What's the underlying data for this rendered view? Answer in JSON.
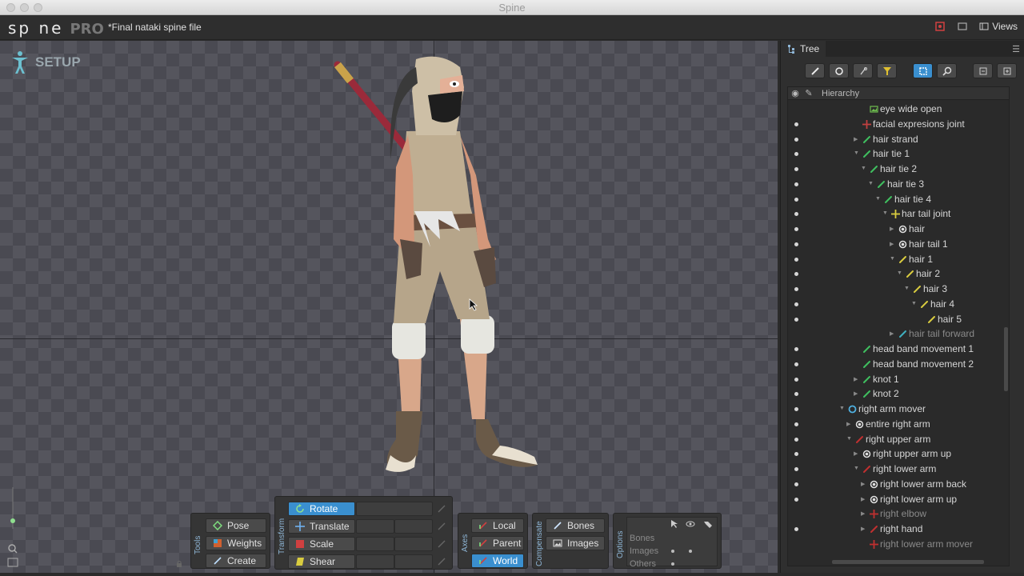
{
  "window": {
    "title": "Spine"
  },
  "header": {
    "logo": "sp ne",
    "logo_pro": "PRO",
    "filename": "*Final nataki spine file",
    "views_label": "Views"
  },
  "viewport": {
    "mode_label": "SETUP"
  },
  "tools": {
    "group_label": "Tools",
    "pose": "Pose",
    "weights": "Weights",
    "create": "Create"
  },
  "transform": {
    "group_label": "Transform",
    "rotate": "Rotate",
    "translate": "Translate",
    "scale": "Scale",
    "shear": "Shear"
  },
  "axes": {
    "group_label": "Axes",
    "local": "Local",
    "parent": "Parent",
    "world": "World"
  },
  "compensate": {
    "group_label": "Compensate",
    "bones": "Bones",
    "images": "Images"
  },
  "options": {
    "group_label": "Options",
    "rows": [
      "Bones",
      "Images",
      "Others"
    ]
  },
  "tree": {
    "tab_label": "Tree",
    "header_label": "Hierarchy",
    "rows": [
      {
        "label": "eye wide open",
        "depth": 7,
        "icon": "image-icon",
        "vis": false,
        "arrow": "",
        "color": "#6fbf4f"
      },
      {
        "label": "facial expresions joint",
        "depth": 6,
        "icon": "bone-joint-icon",
        "vis": true,
        "arrow": "",
        "color": "#c04040"
      },
      {
        "label": "hair strand",
        "depth": 6,
        "icon": "bone-icon",
        "vis": true,
        "arrow": "right",
        "color": "#3fbf5f"
      },
      {
        "label": "hair tie 1",
        "depth": 6,
        "icon": "bone-icon",
        "vis": true,
        "arrow": "down",
        "color": "#3fbf5f"
      },
      {
        "label": "hair tie 2",
        "depth": 7,
        "icon": "bone-icon",
        "vis": true,
        "arrow": "down",
        "color": "#3fbf5f"
      },
      {
        "label": "hair tie 3",
        "depth": 8,
        "icon": "bone-icon",
        "vis": true,
        "arrow": "down",
        "color": "#3fbf5f"
      },
      {
        "label": "hair tie 4",
        "depth": 9,
        "icon": "bone-icon",
        "vis": true,
        "arrow": "down",
        "color": "#3fbf5f"
      },
      {
        "label": "har tail joint",
        "depth": 10,
        "icon": "bone-joint-icon",
        "vis": true,
        "arrow": "down",
        "color": "#d9cc3f"
      },
      {
        "label": "hair",
        "depth": 11,
        "icon": "slot-icon",
        "vis": true,
        "arrow": "right",
        "color": "#e0e0e0"
      },
      {
        "label": "hair tail 1",
        "depth": 11,
        "icon": "slot-icon",
        "vis": true,
        "arrow": "right",
        "color": "#e0e0e0"
      },
      {
        "label": "hair 1",
        "depth": 11,
        "icon": "bone-icon",
        "vis": true,
        "arrow": "down",
        "color": "#d9cc3f"
      },
      {
        "label": "hair 2",
        "depth": 12,
        "icon": "bone-icon",
        "vis": true,
        "arrow": "down",
        "color": "#d9cc3f"
      },
      {
        "label": "hair 3",
        "depth": 13,
        "icon": "bone-icon",
        "vis": true,
        "arrow": "down",
        "color": "#d9cc3f"
      },
      {
        "label": "hair 4",
        "depth": 14,
        "icon": "bone-icon",
        "vis": true,
        "arrow": "down",
        "color": "#d9cc3f"
      },
      {
        "label": "hair 5",
        "depth": 15,
        "icon": "bone-icon",
        "vis": true,
        "arrow": "",
        "color": "#d9cc3f"
      },
      {
        "label": "hair tail forward",
        "depth": 11,
        "icon": "bone-icon",
        "vis": false,
        "arrow": "right",
        "color": "#3fb0bf",
        "dim": true
      },
      {
        "label": "head band movement 1",
        "depth": 6,
        "icon": "bone-icon",
        "vis": true,
        "arrow": "",
        "color": "#3fbf5f"
      },
      {
        "label": "head band movement 2",
        "depth": 6,
        "icon": "bone-icon",
        "vis": true,
        "arrow": "",
        "color": "#3fbf5f"
      },
      {
        "label": "knot 1",
        "depth": 6,
        "icon": "bone-icon",
        "vis": true,
        "arrow": "right",
        "color": "#3fbf5f"
      },
      {
        "label": "knot 2",
        "depth": 6,
        "icon": "bone-icon",
        "vis": true,
        "arrow": "right",
        "color": "#3fbf5f"
      },
      {
        "label": "right arm mover",
        "depth": 4,
        "icon": "ik-icon",
        "vis": true,
        "arrow": "down",
        "color": "#4fb0e0"
      },
      {
        "label": "entire right arm",
        "depth": 5,
        "icon": "slot-icon",
        "vis": true,
        "arrow": "right",
        "color": "#e0e0e0"
      },
      {
        "label": "right upper arm",
        "depth": 5,
        "icon": "bone-icon",
        "vis": true,
        "arrow": "down",
        "color": "#c03030"
      },
      {
        "label": "right upper arm up",
        "depth": 6,
        "icon": "slot-icon",
        "vis": true,
        "arrow": "right",
        "color": "#e0e0e0"
      },
      {
        "label": "right lower arm",
        "depth": 6,
        "icon": "bone-icon",
        "vis": true,
        "arrow": "down",
        "color": "#c03030"
      },
      {
        "label": "right lower arm back",
        "depth": 7,
        "icon": "slot-icon",
        "vis": true,
        "arrow": "right",
        "color": "#e0e0e0"
      },
      {
        "label": "right lower arm up",
        "depth": 7,
        "icon": "slot-icon",
        "vis": true,
        "arrow": "right",
        "color": "#e0e0e0"
      },
      {
        "label": "right elbow",
        "depth": 7,
        "icon": "bone-joint-icon",
        "vis": false,
        "arrow": "right",
        "color": "#c03030",
        "dim": true
      },
      {
        "label": "right hand",
        "depth": 7,
        "icon": "bone-icon",
        "vis": true,
        "arrow": "right",
        "color": "#c03030"
      },
      {
        "label": "right lower arm mover",
        "depth": 7,
        "icon": "bone-joint-icon",
        "vis": false,
        "arrow": "",
        "color": "#c03030",
        "dim": true
      }
    ]
  },
  "colors": {
    "accent": "#3a8fcf",
    "panel_bg": "#2f2f2f"
  }
}
